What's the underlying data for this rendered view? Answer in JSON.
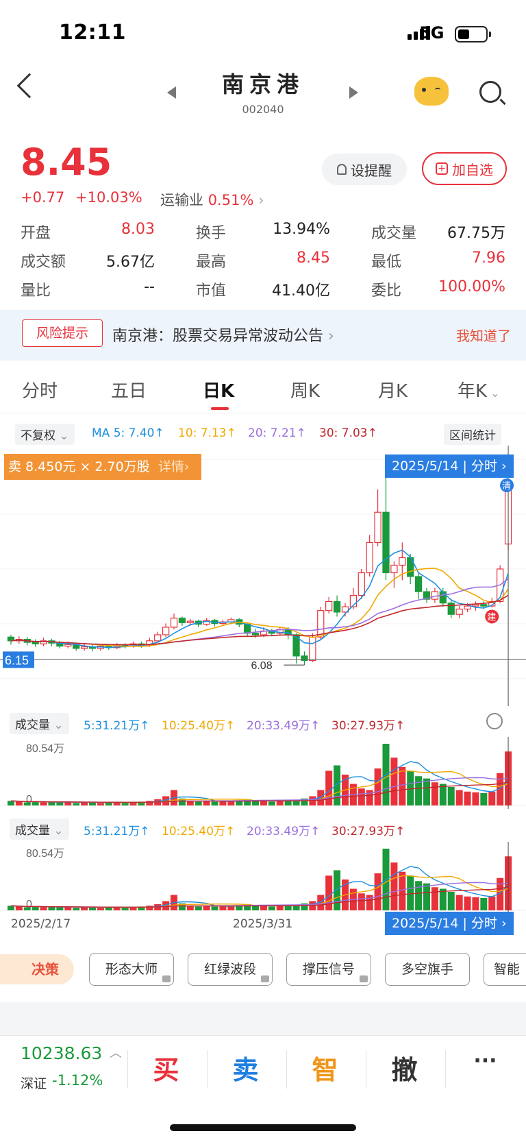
{
  "status": {
    "time": "12:11",
    "network": "5G"
  },
  "header": {
    "title": "南京港",
    "code": "002040"
  },
  "quote": {
    "price": "8.45",
    "change": "+0.77",
    "change_pct": "+10.03%",
    "sector": "运输业",
    "sector_pct": "0.51%",
    "remind_label": "设提醒",
    "add_fav_label": "加自选"
  },
  "stats": [
    {
      "label": "开盘",
      "value": "8.03",
      "color": "red"
    },
    {
      "label": "换手",
      "value": "13.94%",
      "color": "dark"
    },
    {
      "label": "成交量",
      "value": "67.75万",
      "color": "dark"
    },
    {
      "label": "成交额",
      "value": "5.67亿",
      "color": "dark"
    },
    {
      "label": "最高",
      "value": "8.45",
      "color": "red"
    },
    {
      "label": "最低",
      "value": "7.96",
      "color": "red"
    },
    {
      "label": "量比",
      "value": "--",
      "color": "dark"
    },
    {
      "label": "市值",
      "value": "41.40亿",
      "color": "dark"
    },
    {
      "label": "委比",
      "value": "100.00%",
      "color": "red"
    }
  ],
  "risk": {
    "tag": "风险提示",
    "text": "南京港：股票交易异常波动公告",
    "dismiss": "我知道了"
  },
  "tabs": [
    "分时",
    "五日",
    "日K",
    "周K",
    "月K",
    "年K"
  ],
  "kline": {
    "adjust": "不复权",
    "ma5": "MA 5: 7.40",
    "ma10": "10: 7.13",
    "ma20": "20: 7.21",
    "ma30": "30: 7.03",
    "range_stats": "区间统计",
    "sell_info": "卖 8.450元 × 2.70万股",
    "detail": "详情",
    "date": "2025/5/14",
    "intraday": "分时",
    "price_mark": "6.15",
    "low_label": "6.08",
    "markers": {
      "clear": "清",
      "build": "建"
    }
  },
  "volume": {
    "label": "成交量",
    "ma5": "5:31.21万",
    "ma10": "10:25.40万",
    "ma20": "20:33.49万",
    "ma30": "30:27.93万",
    "max": "80.54万",
    "zero": "0"
  },
  "dates": [
    "2025/2/17",
    "2025/3/31"
  ],
  "colors": {
    "up": "#e8313a",
    "down": "#1a9a3a",
    "ma5": "#1e90e0",
    "ma10": "#f0a800",
    "ma20": "#9b6fe0",
    "ma30": "#c0282e",
    "accent": "#2a7de1"
  },
  "strategies": {
    "main": "决策",
    "items": [
      "形态大师",
      "红绿波段",
      "撑压信号",
      "多空旗手",
      "智能"
    ]
  },
  "bottom": {
    "index_value": "10238.63",
    "index_name": "深证",
    "index_change": "-1.12%",
    "actions": [
      "买",
      "卖",
      "智",
      "撤",
      "···"
    ]
  },
  "chart_data": {
    "type": "candlestick",
    "ylim": [
      5.9,
      8.8
    ],
    "candles": [
      [
        6.45,
        6.4,
        6.48,
        6.35
      ],
      [
        6.4,
        6.42,
        6.46,
        6.36
      ],
      [
        6.42,
        6.38,
        6.45,
        6.34
      ],
      [
        6.38,
        6.36,
        6.42,
        6.32
      ],
      [
        6.36,
        6.4,
        6.44,
        6.33
      ],
      [
        6.4,
        6.37,
        6.43,
        6.33
      ],
      [
        6.37,
        6.33,
        6.4,
        6.3
      ],
      [
        6.33,
        6.35,
        6.39,
        6.3
      ],
      [
        6.35,
        6.3,
        6.38,
        6.27
      ],
      [
        6.3,
        6.32,
        6.36,
        6.27
      ],
      [
        6.32,
        6.3,
        6.35,
        6.26
      ],
      [
        6.3,
        6.33,
        6.36,
        6.27
      ],
      [
        6.33,
        6.31,
        6.36,
        6.28
      ],
      [
        6.31,
        6.34,
        6.37,
        6.29
      ],
      [
        6.34,
        6.33,
        6.37,
        6.3
      ],
      [
        6.33,
        6.36,
        6.39,
        6.31
      ],
      [
        6.36,
        6.34,
        6.39,
        6.31
      ],
      [
        6.34,
        6.4,
        6.44,
        6.32
      ],
      [
        6.4,
        6.48,
        6.52,
        6.38
      ],
      [
        6.48,
        6.58,
        6.63,
        6.45
      ],
      [
        6.58,
        6.7,
        6.76,
        6.55
      ],
      [
        6.7,
        6.64,
        6.72,
        6.6
      ],
      [
        6.64,
        6.66,
        6.69,
        6.6
      ],
      [
        6.66,
        6.62,
        6.68,
        6.58
      ],
      [
        6.62,
        6.67,
        6.7,
        6.6
      ],
      [
        6.67,
        6.63,
        6.69,
        6.59
      ],
      [
        6.63,
        6.65,
        6.68,
        6.6
      ],
      [
        6.65,
        6.68,
        6.71,
        6.62
      ],
      [
        6.68,
        6.62,
        6.7,
        6.58
      ],
      [
        6.62,
        6.5,
        6.64,
        6.45
      ],
      [
        6.5,
        6.48,
        6.56,
        6.44
      ],
      [
        6.48,
        6.53,
        6.58,
        6.45
      ],
      [
        6.53,
        6.5,
        6.56,
        6.46
      ],
      [
        6.5,
        6.55,
        6.58,
        6.47
      ],
      [
        6.55,
        6.48,
        6.58,
        6.42
      ],
      [
        6.48,
        6.2,
        6.5,
        6.1
      ],
      [
        6.2,
        6.14,
        6.26,
        6.08
      ],
      [
        6.14,
        6.45,
        6.5,
        6.12
      ],
      [
        6.45,
        6.8,
        6.85,
        6.42
      ],
      [
        6.8,
        6.92,
        6.98,
        6.76
      ],
      [
        6.92,
        6.78,
        7.0,
        6.72
      ],
      [
        6.78,
        6.85,
        6.9,
        6.72
      ],
      [
        6.85,
        7.0,
        7.1,
        6.82
      ],
      [
        7.0,
        7.3,
        7.35,
        6.95
      ],
      [
        7.3,
        7.7,
        7.8,
        7.25
      ],
      [
        7.7,
        8.1,
        8.4,
        7.65
      ],
      [
        8.1,
        7.3,
        8.7,
        7.2
      ],
      [
        7.3,
        7.4,
        7.45,
        7.1
      ],
      [
        7.4,
        7.5,
        7.7,
        7.2
      ],
      [
        7.5,
        7.25,
        7.55,
        7.15
      ],
      [
        7.25,
        7.05,
        7.3,
        6.95
      ],
      [
        7.05,
        6.95,
        7.1,
        6.9
      ],
      [
        6.95,
        7.05,
        7.1,
        6.9
      ],
      [
        7.05,
        6.9,
        7.1,
        6.85
      ],
      [
        6.9,
        6.75,
        6.95,
        6.7
      ],
      [
        6.75,
        6.82,
        6.86,
        6.7
      ],
      [
        6.82,
        6.86,
        6.9,
        6.78
      ],
      [
        6.86,
        6.88,
        6.92,
        6.8
      ],
      [
        6.88,
        6.86,
        6.92,
        6.82
      ],
      [
        6.86,
        6.92,
        6.97,
        6.84
      ],
      [
        6.92,
        7.35,
        7.4,
        6.9
      ],
      [
        7.68,
        8.45,
        8.45,
        7.6
      ]
    ],
    "volume": [
      6,
      5,
      4,
      5,
      4,
      4,
      5,
      4,
      3,
      4,
      4,
      3,
      4,
      4,
      3,
      4,
      5,
      6,
      8,
      12,
      20,
      9,
      6,
      5,
      6,
      5,
      5,
      6,
      6,
      8,
      7,
      6,
      5,
      6,
      6,
      7,
      9,
      12,
      20,
      45,
      52,
      40,
      28,
      22,
      20,
      48,
      80,
      62,
      50,
      45,
      38,
      35,
      30,
      28,
      24,
      20,
      18,
      17,
      16,
      18,
      42,
      70
    ]
  }
}
